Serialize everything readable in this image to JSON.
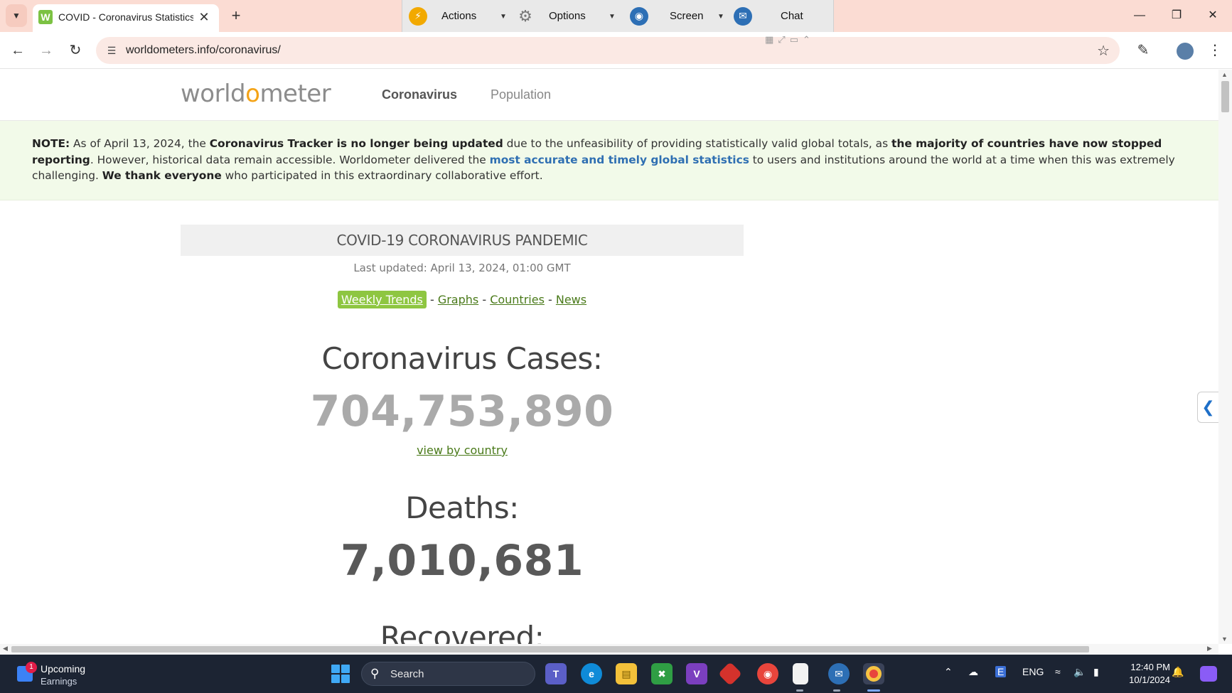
{
  "browser": {
    "tab_title": "COVID - Coronavirus Statistics - Worldometer",
    "favicon_letter": "W",
    "url": "worldometers.info/coronavirus/"
  },
  "remote_toolbar": {
    "actions": "Actions",
    "options": "Options",
    "screen": "Screen",
    "chat": "Chat"
  },
  "site": {
    "logo_pre": "world",
    "logo_o": "o",
    "logo_post": "meter",
    "nav_coronavirus": "Coronavirus",
    "nav_population": "Population"
  },
  "note": {
    "label": "NOTE:",
    "t1": " As of April 13, 2024, the ",
    "b1": "Coronavirus Tracker is no longer being updated",
    "t2": " due to the unfeasibility of providing statistically valid global totals, as ",
    "b2": "the majority of countries have now stopped reporting",
    "t3": ". However, historical data remain accessible. Worldometer delivered the ",
    "link": "most accurate and timely global statistics",
    "t4": " to users and institutions around the world at a time when this was extremely challenging. ",
    "b3": "We thank everyone",
    "t5": " who participated in this extraordinary collaborative effort."
  },
  "main": {
    "pandemic_title": "COVID-19 CORONAVIRUS PANDEMIC",
    "last_updated": "Last updated: April 13, 2024, 01:00 GMT",
    "links": {
      "weekly": "Weekly Trends",
      "graphs": "Graphs",
      "countries": "Countries",
      "news": "News",
      "sep": " - "
    },
    "cases_label": "Coronavirus Cases:",
    "cases_value": "704,753,890",
    "cases_color": "#aaaaaa",
    "view_by_country": "view by country",
    "deaths_label": "Deaths:",
    "deaths_value": "7,010,681",
    "deaths_color": "#595959",
    "recovered_label": "Recovered:"
  },
  "taskbar": {
    "weather_badge": "1",
    "weather_line1": "Upcoming",
    "weather_line2": "Earnings",
    "search": "Search",
    "lang": "ENG",
    "time": "12:40 PM",
    "date": "10/1/2024"
  }
}
